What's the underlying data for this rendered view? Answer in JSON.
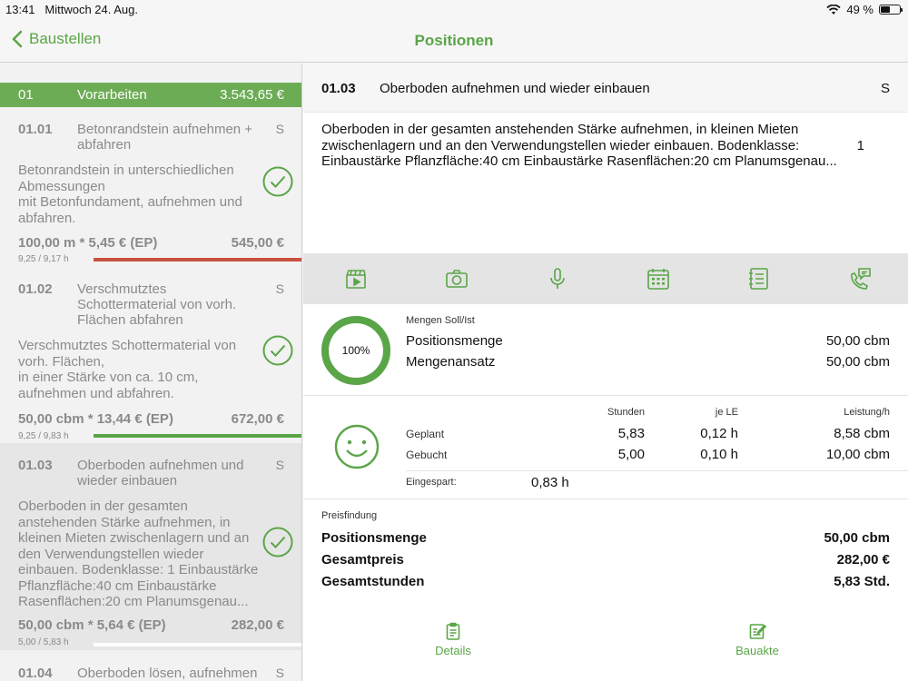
{
  "status": {
    "time": "13:41",
    "date": "Mittwoch 24. Aug.",
    "battery": "49 %",
    "battery_level": 0.49
  },
  "nav": {
    "back_label": "Baustellen",
    "title": "Positionen"
  },
  "colors": {
    "accent": "#5aa547",
    "group_bg": "#6cac55",
    "bar_red": "#c9513f",
    "bar_green": "#5aa547"
  },
  "list": {
    "group": {
      "num": "01",
      "title": "Vorarbeiten",
      "price": "3.543,65 €"
    },
    "items": [
      {
        "num": "01.01",
        "title": "Betonrandstein aufnehmen + abfahren",
        "s": "S",
        "desc": "Betonrandstein in unterschiedlichen Abmessungen\nmit Betonfundament, aufnehmen und abfahren.",
        "calc": "100,00 m * 5,45 € (EP)",
        "price": "545,00 €",
        "hours": "9,25 / 9,17 h",
        "progress": 1.0
      },
      {
        "num": "01.02",
        "title": "Verschmutztes Schottermaterial von vorh. Flächen abfahren",
        "s": "S",
        "desc": "Verschmutztes Schottermaterial von vorh. Flächen,\nin einer Stärke von ca. 10 cm, aufnehmen und abfahren.",
        "calc": "50,00 cbm * 13,44 € (EP)",
        "price": "672,00 €",
        "hours": "9,25 / 9,83 h",
        "progress": 1.0
      },
      {
        "num": "01.03",
        "title": "Oberboden aufnehmen und wieder einbauen",
        "s": "S",
        "desc": "Oberboden in der gesamten anstehenden Stärke aufnehmen, in kleinen Mieten zwischenlagern und an den Verwendungstellen wieder einbauen. Bodenklasse:                1 Einbaustärke Pflanzfläche:40 cm Einbaustärke Rasenflächen:20 cm Planumsgenau...",
        "calc": "50,00 cbm * 5,64 € (EP)",
        "price": "282,00 €",
        "hours": "5,00 / 5,83 h",
        "progress": 0.0
      },
      {
        "num": "01.04",
        "title": "Oberboden lösen, aufnehmen",
        "s": "S"
      }
    ]
  },
  "detail": {
    "num": "01.03",
    "title": "Oberboden aufnehmen und wieder einbauen",
    "s": "S",
    "longtext": "Oberboden in der gesamten anstehenden Stärke aufnehmen, in kleinen Mieten zwischenlagern und an den Verwendungstellen wieder einbauen. Bodenklasse:\nEinbaustärke Pflanzfläche:40 cm Einbaustärke Rasenflächen:20 cm Planumsgenau...",
    "qty_number": "1",
    "mengen": {
      "label": "Mengen Soll/Ist",
      "percent": "100%",
      "percent_value": 1.0,
      "rows": [
        {
          "label": "Positionsmenge",
          "value": "50,00 cbm"
        },
        {
          "label": "Mengenansatz",
          "value": "50,00 cbm"
        }
      ]
    },
    "leistung": {
      "columns": [
        "Stunden",
        "je LE",
        "Leistung/h"
      ],
      "rows": [
        {
          "label": "Geplant",
          "stunden": "5,83",
          "je_le": "0,12 h",
          "leistung": "8,58 cbm"
        },
        {
          "label": "Gebucht",
          "stunden": "5,00",
          "je_le": "0,10 h",
          "leistung": "10,00 cbm"
        }
      ],
      "saved_label": "Eingespart:",
      "saved_value": "0,83 h"
    },
    "preis": {
      "label": "Preisfindung",
      "rows": [
        {
          "label": "Positionsmenge",
          "value": "50,00 cbm"
        },
        {
          "label": "Gesamtpreis",
          "value": "282,00 €"
        },
        {
          "label": "Gesamtstunden",
          "value": "5,83 Std."
        }
      ]
    },
    "toolbar_icons": [
      "clapperboard-icon",
      "camera-icon",
      "microphone-icon",
      "calendar-icon",
      "notes-list-icon",
      "phone-chat-icon"
    ],
    "tabs": [
      {
        "label": "Details",
        "icon": "clipboard-icon"
      },
      {
        "label": "Bauakte",
        "icon": "edit-document-icon"
      }
    ]
  }
}
